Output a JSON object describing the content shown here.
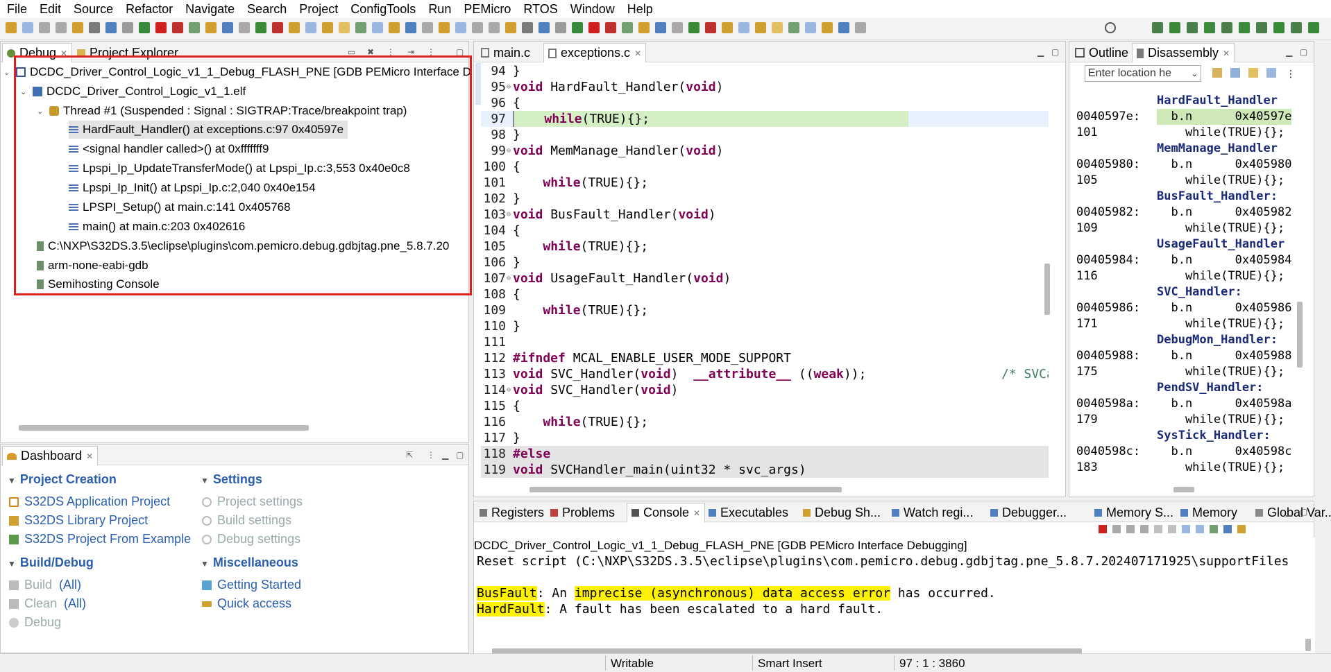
{
  "menu": [
    "File",
    "Edit",
    "Source",
    "Refactor",
    "Navigate",
    "Search",
    "Project",
    "ConfigTools",
    "Run",
    "PEMicro",
    "RTOS",
    "Window",
    "Help"
  ],
  "debug_view": {
    "tabs": [
      "Debug",
      "Project Explorer"
    ],
    "tree": {
      "launch": "DCDC_Driver_Control_Logic_v1_1_Debug_FLASH_PNE [GDB PEMicro Interface D",
      "elf": "DCDC_Driver_Control_Logic_v1_1.elf",
      "thread": "Thread #1 (Suspended : Signal : SIGTRAP:Trace/breakpoint trap)",
      "frames": [
        "HardFault_Handler() at exceptions.c:97 0x40597e",
        "<signal handler called>() at 0xfffffff9",
        "Lpspi_Ip_UpdateTransferMode() at Lpspi_Ip.c:3,553 0x40e0c8",
        "Lpspi_Ip_Init() at Lpspi_Ip.c:2,040 0x40e154",
        "LPSPI_Setup() at main.c:141 0x405768",
        "main() at main.c:203 0x402616"
      ],
      "processes": [
        "C:\\NXP\\S32DS.3.5\\eclipse\\plugins\\com.pemicro.debug.gdbjtag.pne_5.8.7.20",
        "arm-none-eabi-gdb",
        "Semihosting Console"
      ]
    }
  },
  "dashboard": {
    "tab": "Dashboard",
    "project_creation": {
      "title": "Project Creation",
      "items": [
        "S32DS Application Project",
        "S32DS Library Project",
        "S32DS Project From Example"
      ]
    },
    "settings": {
      "title": "Settings",
      "items": [
        "Project settings",
        "Build settings",
        "Debug settings"
      ]
    },
    "build_debug": {
      "title": "Build/Debug",
      "build": "Build",
      "build_all": "(All)",
      "clean": "Clean",
      "clean_all": "(All)",
      "debug": "Debug"
    },
    "misc": {
      "title": "Miscellaneous",
      "items": [
        "Getting Started",
        "Quick access"
      ]
    }
  },
  "editor": {
    "tabs": [
      "main.c",
      "exceptions.c"
    ],
    "lines": [
      {
        "n": "94",
        "code": "}"
      },
      {
        "n": "95",
        "code": "void HardFault_Handler(void)",
        "fold": true
      },
      {
        "n": "96",
        "code": "{"
      },
      {
        "n": "97",
        "code": "    while(TRUE){};",
        "current": true
      },
      {
        "n": "98",
        "code": "}"
      },
      {
        "n": "99",
        "code": "void MemManage_Handler(void)",
        "fold": true
      },
      {
        "n": "100",
        "code": "{"
      },
      {
        "n": "101",
        "code": "    while(TRUE){};"
      },
      {
        "n": "102",
        "code": "}"
      },
      {
        "n": "103",
        "code": "void BusFault_Handler(void)",
        "fold": true
      },
      {
        "n": "104",
        "code": "{"
      },
      {
        "n": "105",
        "code": "    while(TRUE){};"
      },
      {
        "n": "106",
        "code": "}"
      },
      {
        "n": "107",
        "code": "void UsageFault_Handler(void)",
        "fold": true
      },
      {
        "n": "108",
        "code": "{"
      },
      {
        "n": "109",
        "code": "    while(TRUE){};"
      },
      {
        "n": "110",
        "code": "}"
      },
      {
        "n": "111",
        "code": ""
      },
      {
        "n": "112",
        "code": "#ifndef MCAL_ENABLE_USER_MODE_SUPPORT"
      },
      {
        "n": "113",
        "code": "void SVC_Handler(void)  __attribute__ ((weak));",
        "comment": "/* SVCa"
      },
      {
        "n": "114",
        "code": "void SVC_Handler(void)",
        "fold": true
      },
      {
        "n": "115",
        "code": "{"
      },
      {
        "n": "116",
        "code": "    while(TRUE){};"
      },
      {
        "n": "117",
        "code": "}"
      },
      {
        "n": "118",
        "code": "#else",
        "inactive": true
      },
      {
        "n": "119",
        "code": "void SVCHandler_main(uint32 * svc_args)",
        "inactive": true
      }
    ]
  },
  "outline_view": {
    "tabs": [
      "Outline",
      "Disassembly"
    ],
    "location_placeholder": "Enter location he",
    "rows": [
      {
        "type": "fn",
        "text": "HardFault_Handler"
      },
      {
        "type": "ins",
        "addr": "0040597e:",
        "text": "  b.n      0x40597e",
        "current": true
      },
      {
        "type": "src",
        "addr": "101",
        "text": "    while(TRUE){};"
      },
      {
        "type": "fn",
        "text": "MemManage_Handler"
      },
      {
        "type": "ins",
        "addr": "00405980:",
        "text": "  b.n      0x405980"
      },
      {
        "type": "src",
        "addr": "105",
        "text": "    while(TRUE){};"
      },
      {
        "type": "fn",
        "text": "BusFault_Handler:"
      },
      {
        "type": "ins",
        "addr": "00405982:",
        "text": "  b.n      0x405982"
      },
      {
        "type": "src",
        "addr": "109",
        "text": "    while(TRUE){};"
      },
      {
        "type": "fn",
        "text": "UsageFault_Handler"
      },
      {
        "type": "ins",
        "addr": "00405984:",
        "text": "  b.n      0x405984"
      },
      {
        "type": "src",
        "addr": "116",
        "text": "    while(TRUE){};"
      },
      {
        "type": "fn",
        "text": "SVC_Handler:"
      },
      {
        "type": "ins",
        "addr": "00405986:",
        "text": "  b.n      0x405986"
      },
      {
        "type": "src",
        "addr": "171",
        "text": "    while(TRUE){};"
      },
      {
        "type": "fn",
        "text": "DebugMon_Handler:"
      },
      {
        "type": "ins",
        "addr": "00405988:",
        "text": "  b.n      0x405988"
      },
      {
        "type": "src",
        "addr": "175",
        "text": "    while(TRUE){};"
      },
      {
        "type": "fn",
        "text": "PendSV_Handler:"
      },
      {
        "type": "ins",
        "addr": "0040598a:",
        "text": "  b.n      0x40598a"
      },
      {
        "type": "src",
        "addr": "179",
        "text": "    while(TRUE){};"
      },
      {
        "type": "fn",
        "text": "SysTick_Handler:"
      },
      {
        "type": "ins",
        "addr": "0040598c:",
        "text": "  b.n      0x40598c"
      },
      {
        "type": "src",
        "addr": "183",
        "text": "    while(TRUE){};"
      }
    ]
  },
  "console_view": {
    "tabs": [
      "Registers",
      "Problems",
      "Console",
      "Executables",
      "Debug Sh...",
      "Watch regi...",
      "Debugger...",
      "Memory S...",
      "Memory",
      "Global Var..."
    ],
    "header": "DCDC_Driver_Control_Logic_v1_1_Debug_FLASH_PNE [GDB PEMicro Interface Debugging]",
    "line1": "Reset script (C:\\NXP\\S32DS.3.5\\eclipse\\plugins\\com.pemicro.debug.gdbjtag.pne_5.8.7.202407171925\\supportFiles",
    "line2_a": "BusFault",
    "line2_b": ": An ",
    "line2_c": "imprecise (asynchronous) data access error",
    "line2_d": " has occurred.",
    "line3_a": "HardFault",
    "line3_b": ": A fault has been escalated to a hard fault."
  },
  "status": {
    "writable": "Writable",
    "insert": "Smart Insert",
    "position": "97 : 1 : 3860"
  },
  "colors": {
    "accent": "#2b5fae",
    "highlight_box": "#e0201c",
    "console_highlight": "#fff200"
  }
}
